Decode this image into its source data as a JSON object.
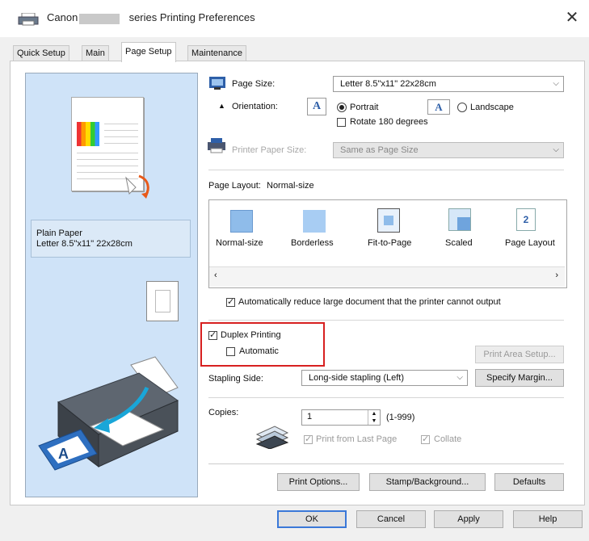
{
  "window": {
    "title_prefix": "Canon",
    "title_suffix": "series Printing Preferences",
    "close_icon": "close-icon"
  },
  "tabs": [
    {
      "label": "Quick Setup",
      "active": false
    },
    {
      "label": "Main",
      "active": false
    },
    {
      "label": "Page Setup",
      "active": true
    },
    {
      "label": "Maintenance",
      "active": false
    }
  ],
  "preview": {
    "media_type": "Plain Paper",
    "paper_size": "Letter 8.5\"x11\" 22x28cm"
  },
  "page_size": {
    "label": "Page Size:",
    "value": "Letter 8.5\"x11\" 22x28cm"
  },
  "orientation": {
    "label": "Orientation:",
    "portrait": "Portrait",
    "landscape": "Landscape",
    "selected": "Portrait",
    "rotate_label": "Rotate 180 degrees",
    "rotate_checked": false
  },
  "printer_paper_size": {
    "label": "Printer Paper Size:",
    "value": "Same as Page Size"
  },
  "page_layout": {
    "label": "Page Layout:",
    "current": "Normal-size",
    "options": [
      "Normal-size",
      "Borderless",
      "Fit-to-Page",
      "Scaled",
      "Page Layout"
    ],
    "page_layout_icon_number": "2"
  },
  "auto_reduce": {
    "label": "Automatically reduce large document that the printer cannot output",
    "checked": true
  },
  "duplex": {
    "label": "Duplex Printing",
    "checked": true,
    "automatic_label": "Automatic",
    "automatic_checked": false,
    "print_area_setup": "Print Area Setup..."
  },
  "stapling": {
    "label": "Stapling Side:",
    "value": "Long-side stapling (Left)",
    "specify_margin": "Specify Margin..."
  },
  "copies": {
    "label": "Copies:",
    "value": "1",
    "range": "(1-999)",
    "print_from_last_label": "Print from Last Page",
    "print_from_last_checked": true,
    "collate_label": "Collate",
    "collate_checked": true
  },
  "buttons": {
    "print_options": "Print Options...",
    "stamp_background": "Stamp/Background...",
    "defaults": "Defaults",
    "ok": "OK",
    "cancel": "Cancel",
    "apply": "Apply",
    "help": "Help"
  },
  "colors": {
    "preview_bg": "#cfe3f8",
    "highlight_frame": "#d72020",
    "accent": "#3a78d8"
  }
}
